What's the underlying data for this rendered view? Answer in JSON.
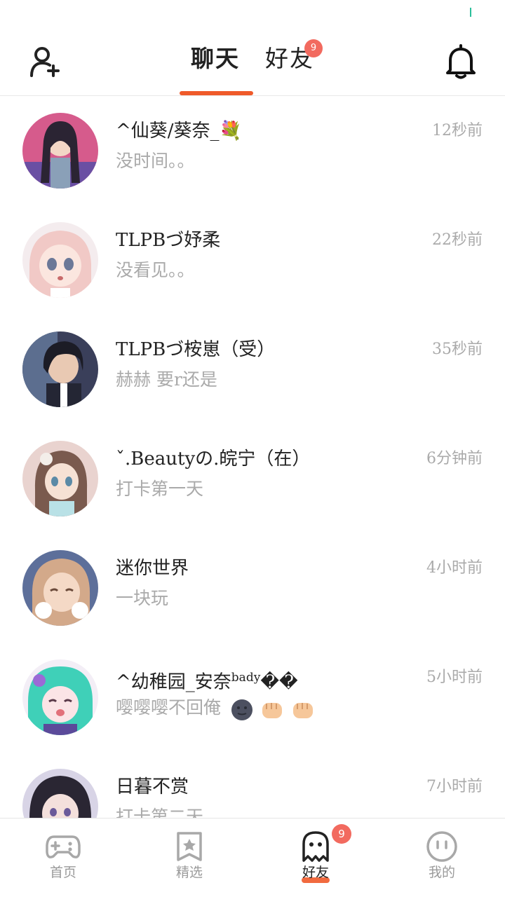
{
  "header": {
    "tabs": [
      {
        "label": "聊天",
        "active": true
      },
      {
        "label": "好友",
        "active": false,
        "badge": "9"
      }
    ]
  },
  "chats": [
    {
      "name": "^仙葵/葵奈_💐",
      "time": "12秒前",
      "message": "没时间。。"
    },
    {
      "name": "TLPBづ妤柔",
      "time": "22秒前",
      "message": "没看见。。"
    },
    {
      "name": "TLPBづ桉崽（受）",
      "time": "35秒前",
      "message": "赫赫  要r还是"
    },
    {
      "name": "ˇ.Beautyの.皖宁（在）",
      "time": "6分钟前",
      "message": "打卡第一天"
    },
    {
      "name": "迷你世界",
      "time": "4小时前",
      "message": "一块玩"
    },
    {
      "name": "^幼稚园_安奈",
      "name_sup": "bady",
      "name_tail": "��",
      "time": "5小时前",
      "message": "嘤嘤嘤不回俺"
    },
    {
      "name": "日暮不赏",
      "time": "7小时前",
      "message": "打卡第二天"
    }
  ],
  "bottom_nav": [
    {
      "label": "首页",
      "icon": "gamepad-icon",
      "active": false
    },
    {
      "label": "精选",
      "icon": "star-icon",
      "active": false
    },
    {
      "label": "好友",
      "icon": "ghost-icon",
      "active": true,
      "badge": "9"
    },
    {
      "label": "我的",
      "icon": "face-icon",
      "active": false
    }
  ],
  "colors": {
    "accent": "#ef5a2a",
    "badge": "#f26a5f",
    "muted_text": "#aaaaaa",
    "status_mark": "#2bbf9a"
  }
}
